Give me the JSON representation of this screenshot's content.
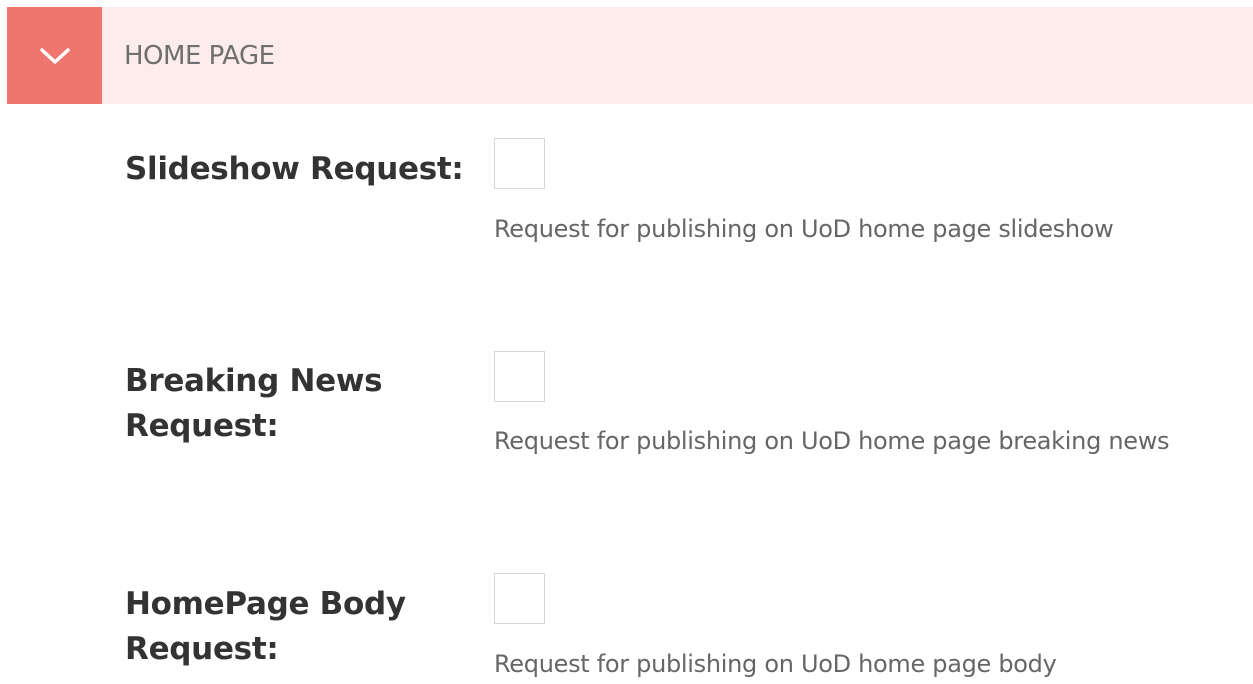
{
  "section": {
    "title": "HOME PAGE",
    "toggle_icon": "chevron-down-icon"
  },
  "fields": [
    {
      "label": "Slideshow Request:",
      "checked": false,
      "help": "Request for publishing on UoD home page slideshow"
    },
    {
      "label_line1": "Breaking News",
      "label_line2": "Request:",
      "checked": false,
      "help": "Request for publishing on UoD home page breaking news"
    },
    {
      "label_line1": "HomePage Body",
      "label_line2": "Request:",
      "checked": false,
      "help": "Request for publishing on UoD home page body"
    }
  ],
  "colors": {
    "accent": "#f0756f",
    "header_bg": "#fcecec"
  }
}
